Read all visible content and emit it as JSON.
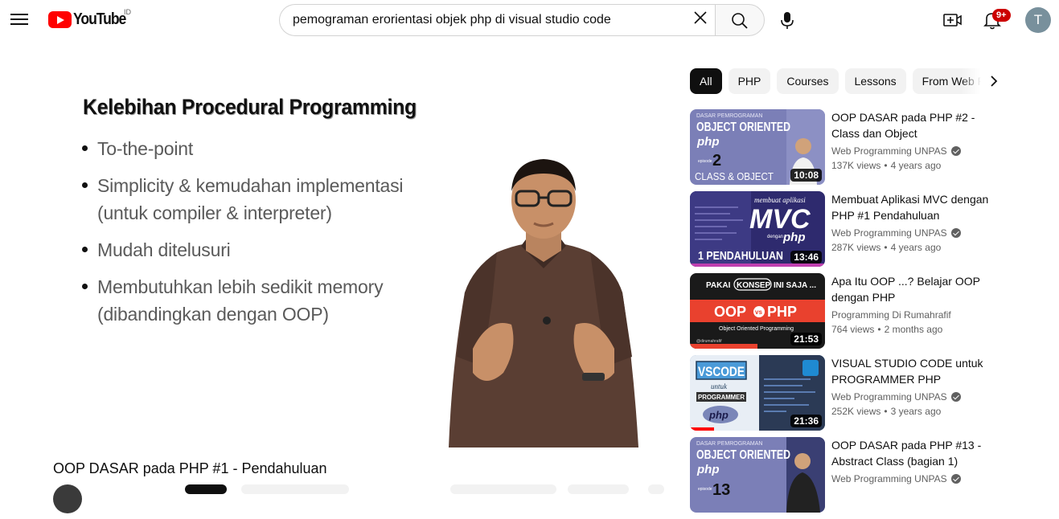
{
  "header": {
    "logo_text": "YouTube",
    "region": "ID",
    "search_value": "pemograman erorientasi objek php di visual studio code",
    "notifications": "9+",
    "avatar_letter": "T"
  },
  "player": {
    "slide_title": "Kelebihan Procedural Programming",
    "bullets": [
      "To-the-point",
      "Simplicity & kemudahan implementasi (untuk compiler & interpreter)",
      "Mudah ditelusuri",
      "Membutuhkan lebih sedikit memory (dibandingkan dengan OOP)"
    ]
  },
  "video": {
    "title": "OOP DASAR pada PHP #1 - Pendahuluan"
  },
  "chips": [
    "All",
    "PHP",
    "Courses",
    "Lessons",
    "From Web Programming UNPAS"
  ],
  "recommendations": [
    {
      "title": "OOP DASAR pada PHP #2 - Class dan Object",
      "channel": "Web Programming UNPAS",
      "views": "137K views",
      "age": "4 years ago",
      "duration": "10:08",
      "thumb": {
        "top": "DASAR PEMROGRAMAN",
        "main": "OBJECT ORIENTED",
        "sub": "php",
        "ep_label": "episode",
        "ep": "2",
        "bottom": "CLASS & OBJECT"
      }
    },
    {
      "title": "Membuat Aplikasi MVC dengan PHP #1 Pendahuluan",
      "channel": "Web Programming UNPAS",
      "views": "287K views",
      "age": "4 years ago",
      "duration": "13:46",
      "thumb": {
        "top": "membuat aplikasi",
        "main": "MVC",
        "sub": "dengan",
        "sub2": "php",
        "bottom": "1 PENDAHULUAN"
      }
    },
    {
      "title": "Apa Itu OOP ...? Belajar OOP dengan PHP",
      "channel": "Programming Di Rumahrafif",
      "views": "764 views",
      "age": "2 months ago",
      "duration": "21:53",
      "thumb": {
        "top_a": "PAKAI",
        "top_b": "KONSEP",
        "top_c": "INI SAJA ...",
        "main_a": "OOP",
        "vs": "vs",
        "main_b": "PHP",
        "sub": "Object Oriented Programming",
        "handle": "@dirumahrafif"
      }
    },
    {
      "title": "VISUAL STUDIO CODE untuk PROGRAMMER PHP",
      "channel": "Web Programming UNPAS",
      "views": "252K views",
      "age": "3 years ago",
      "duration": "21:36",
      "thumb": {
        "main": "VSCODE",
        "sub": "untuk",
        "tag": "PROGRAMMER",
        "php": "php"
      }
    },
    {
      "title": "OOP DASAR pada PHP #13 - Abstract Class (bagian 1)",
      "channel": "Web Programming UNPAS",
      "views": "",
      "age": "",
      "duration": "",
      "thumb": {
        "top": "DASAR PEMROGRAMAN",
        "main": "OBJECT ORIENTED",
        "sub": "php",
        "ep_label": "episode",
        "ep": "13"
      }
    }
  ],
  "colors": {
    "brand_red": "#ff0000",
    "chip_active": "#0f0f0f",
    "oop_thumb_bg": "#7b7fb7",
    "mvc_thumb_bg": "#2e2a6e"
  }
}
